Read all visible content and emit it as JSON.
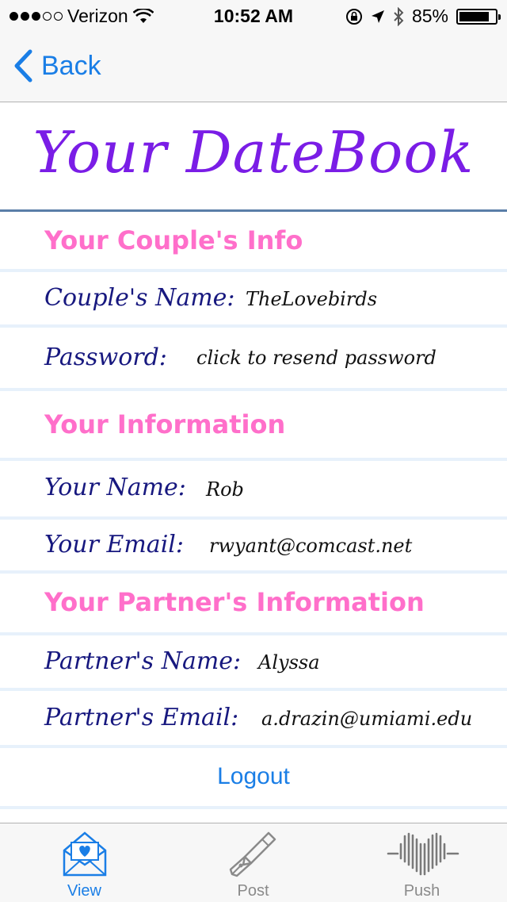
{
  "status_bar": {
    "carrier": "Verizon",
    "time": "10:52 AM",
    "battery": "85%",
    "battery_level": 0.85
  },
  "nav": {
    "back_label": "Back"
  },
  "title": "Your DateBook",
  "sections": {
    "couple": {
      "header": "Your Couple's Info",
      "name_label": "Couple's Name:",
      "name_value": "TheLovebirds",
      "password_label": "Password:",
      "password_value": "click to resend password"
    },
    "you": {
      "header": "Your Information",
      "name_label": "Your Name:",
      "name_value": "Rob",
      "email_label": "Your Email:",
      "email_value": "rwyant@comcast.net"
    },
    "partner": {
      "header": "Your Partner's Information",
      "name_label": "Partner's Name:",
      "name_value": "Alyssa",
      "email_label": "Partner's Email:",
      "email_value": "a.drazin@umiami.edu"
    }
  },
  "logout_label": "Logout",
  "tabs": [
    {
      "label": "View",
      "icon": "envelope-heart-icon",
      "active": true
    },
    {
      "label": "Post",
      "icon": "fountain-pen-icon",
      "active": false
    },
    {
      "label": "Push",
      "icon": "heartbeat-heart-icon",
      "active": false
    }
  ],
  "colors": {
    "accent": "#1a7ee6",
    "title": "#7a1de6",
    "header": "#ff6fca",
    "label": "#17187f"
  }
}
